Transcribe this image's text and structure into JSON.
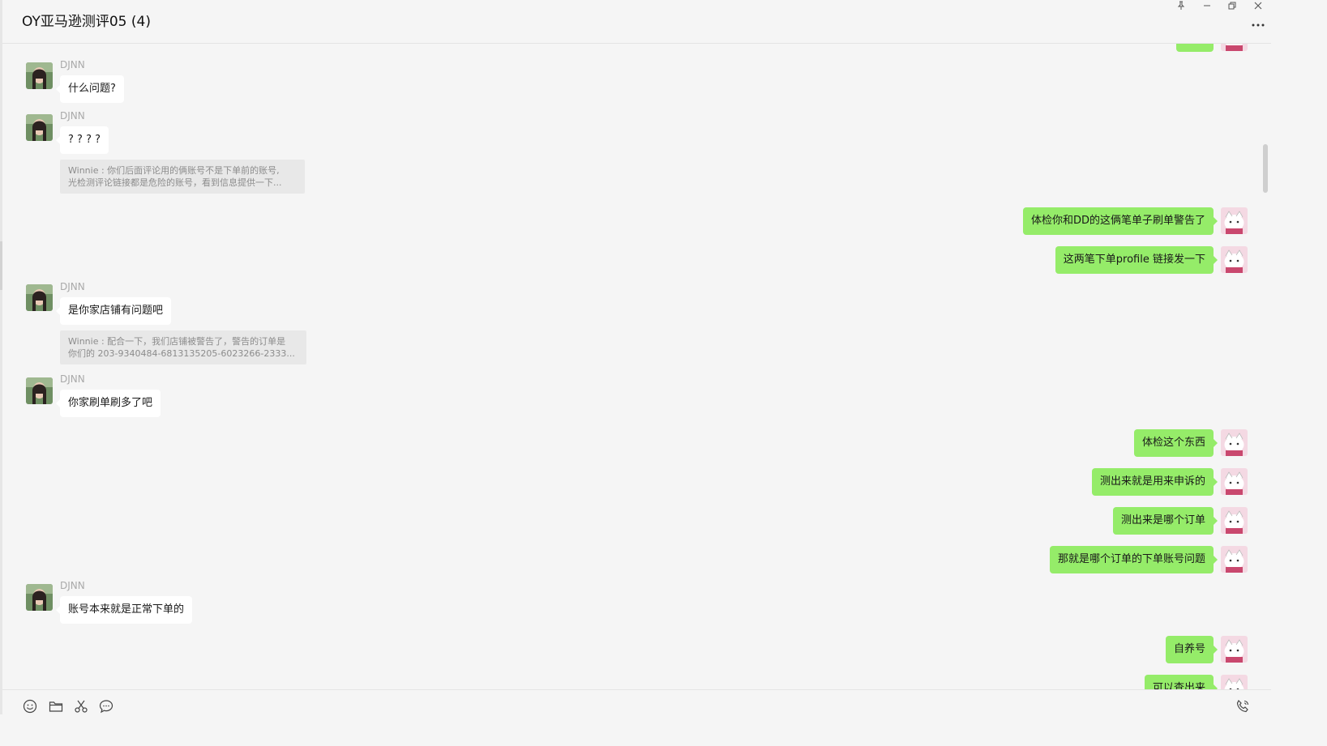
{
  "window": {
    "title": "OY亚马逊测评05 (4)",
    "controls": [
      "pin-icon",
      "minimize-icon",
      "restore-icon",
      "close-icon"
    ],
    "more": "more-icon"
  },
  "colors": {
    "background": "#f5f5f5",
    "bubble_in": "#ffffff",
    "bubble_out": "#95ec69",
    "quote_bg": "#e8e8e8"
  },
  "messages": [
    {
      "sender": "DJNN",
      "text": "什么问题?"
    },
    {
      "sender": "DJNN",
      "text": "? ? ? ?",
      "quote": {
        "line1": "Winnie : 你们后面评论用的俩账号不是下单前的账号,",
        "line2": "光检测评论链接都是危险的账号，看到信息提供一下..."
      }
    },
    {
      "text": "体检你和DD的这俩笔单子刷单警告了"
    },
    {
      "text": "这两笔下单profile 链接发一下"
    },
    {
      "sender": "DJNN",
      "text": "是你家店铺有问题吧",
      "quote": {
        "line1": "Winnie : 配合一下，我们店铺被警告了，警告的订单是",
        "line2": "你们的 203-9340484-6813135205-6023266-2333..."
      }
    },
    {
      "sender": "DJNN",
      "text": "你家刷单刷多了吧"
    },
    {
      "text": "体检这个东西"
    },
    {
      "text": "测出来就是用来申诉的"
    },
    {
      "text": "测出来是哪个订单"
    },
    {
      "text": "那就是哪个订单的下单账号问题"
    },
    {
      "sender": "DJNN",
      "text": "账号本来就是正常下单的"
    },
    {
      "text": "自养号"
    },
    {
      "text": "可以查出来"
    }
  ],
  "toolbar": {
    "left": [
      "emoji-icon",
      "folder-icon",
      "scissors-icon",
      "chat-history-icon"
    ],
    "right": "voice-call-icon"
  }
}
